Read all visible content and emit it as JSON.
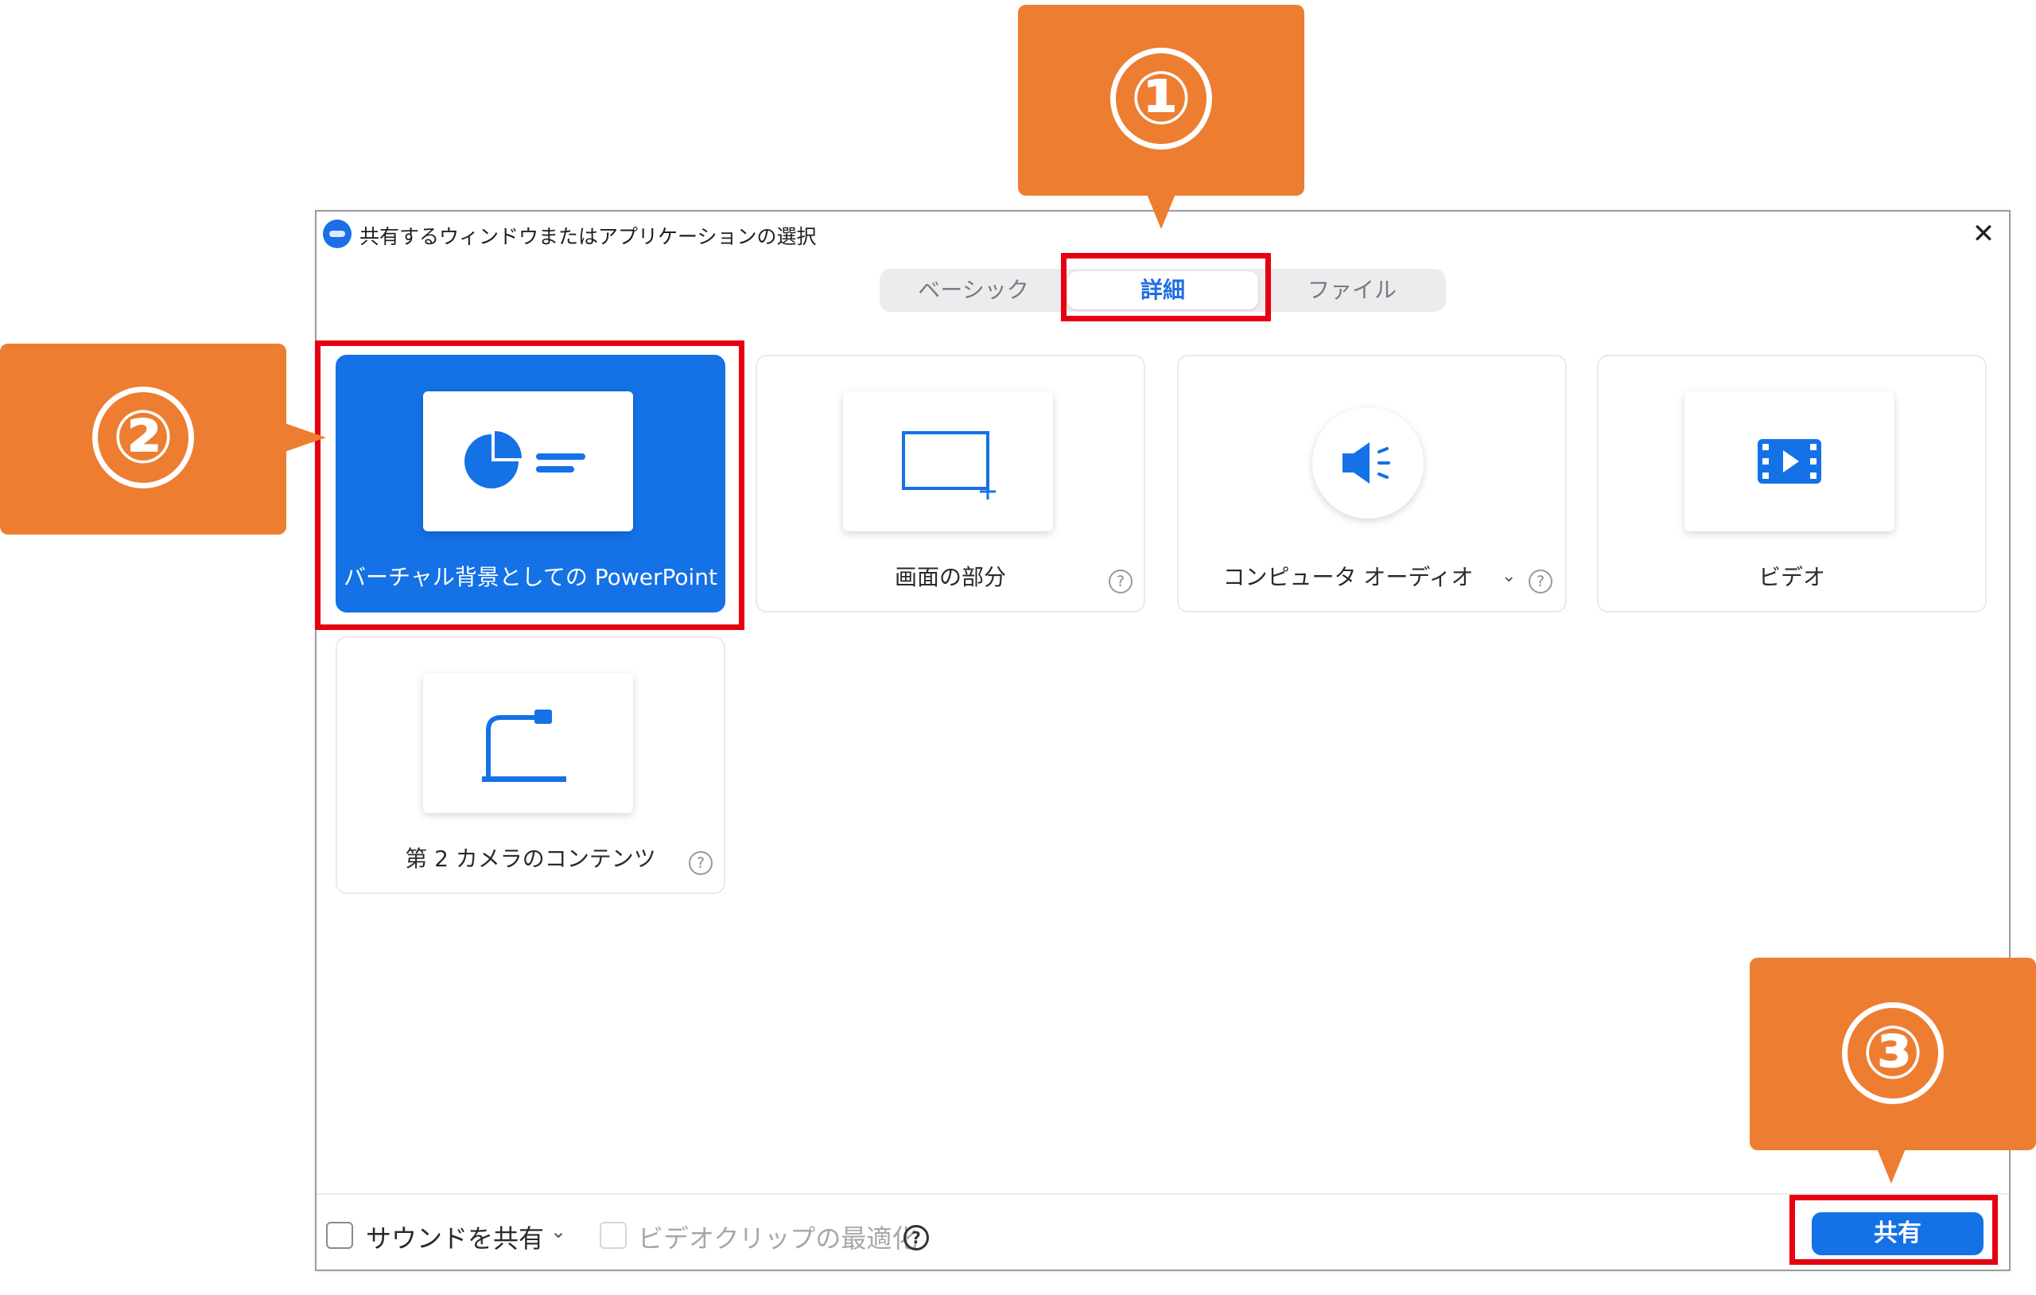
{
  "window": {
    "title": "共有するウィンドウまたはアプリケーションの選択",
    "close_symbol": "✕"
  },
  "tabs": [
    {
      "label": "ベーシック",
      "selected": false
    },
    {
      "label": "詳細",
      "selected": true
    },
    {
      "label": "ファイル",
      "selected": false
    }
  ],
  "cards": [
    {
      "label": "バーチャル背景としての PowerPoint",
      "icon": "powerpoint-pie-chart-icon",
      "selected": true
    },
    {
      "label": "画面の部分",
      "icon": "screen-portion-icon",
      "help": "?"
    },
    {
      "label": "コンピュータ オーディオ",
      "icon": "speaker-icon",
      "dropdown": "⌄",
      "help": "?"
    },
    {
      "label": "ビデオ",
      "icon": "video-film-icon"
    },
    {
      "label": "第 2 カメラのコンテンツ",
      "icon": "document-camera-icon",
      "help": "?"
    }
  ],
  "footer": {
    "sound_label": "サウンドを共有",
    "sound_dropdown": "⌄",
    "optimize_label": "ビデオクリップの最適化",
    "optimize_help": "?",
    "share_button": "共有"
  },
  "callouts": [
    "①",
    "②",
    "③"
  ],
  "colors": {
    "accent_blue": "#1471e6",
    "callout_orange": "#ed7d31",
    "highlight_red": "#e60012"
  }
}
